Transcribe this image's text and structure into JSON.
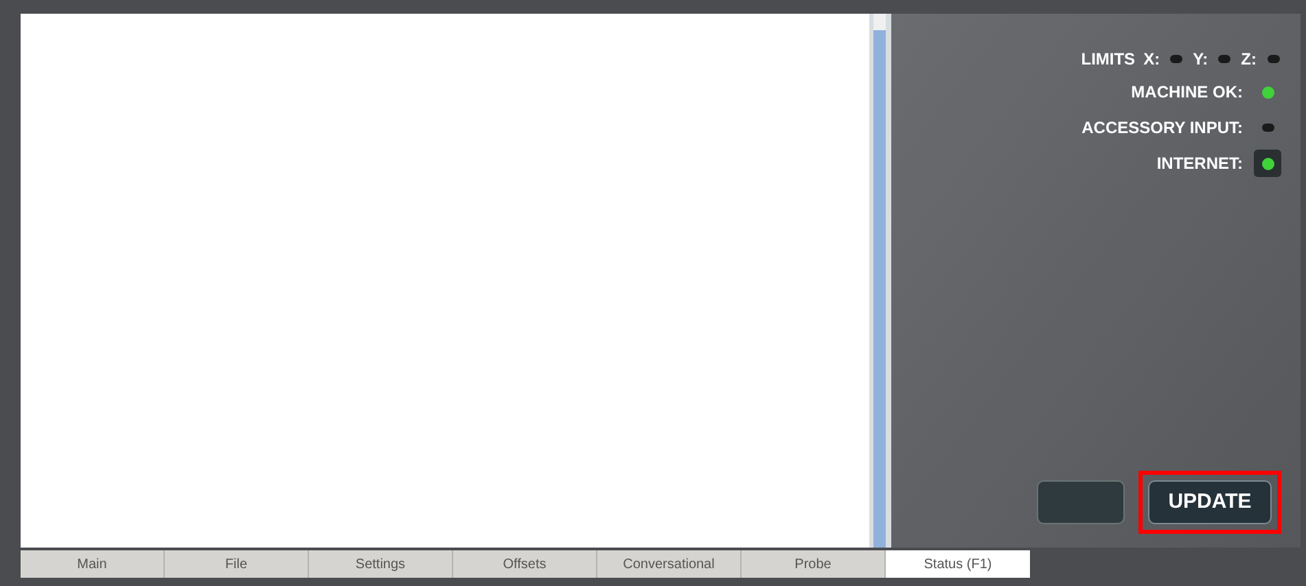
{
  "limits": {
    "label": "LIMITS",
    "axes": [
      {
        "label": "X:",
        "on": false
      },
      {
        "label": "Y:",
        "on": false
      },
      {
        "label": "Z:",
        "on": false
      }
    ]
  },
  "indicators": [
    {
      "label": "MACHINE OK:",
      "on": true,
      "kind": "dot"
    },
    {
      "label": "ACCESSORY INPUT:",
      "on": false,
      "kind": "dot"
    },
    {
      "label": "INTERNET:",
      "on": true,
      "kind": "boxed"
    }
  ],
  "update_button": {
    "label": "UPDATE",
    "highlighted": true
  },
  "tabs": [
    {
      "label": "Main",
      "selected": false
    },
    {
      "label": "File",
      "selected": false
    },
    {
      "label": "Settings",
      "selected": false
    },
    {
      "label": "Offsets",
      "selected": false
    },
    {
      "label": "Conversational",
      "selected": false
    },
    {
      "label": "Probe",
      "selected": false
    },
    {
      "label": "Status (F1)",
      "selected": true
    }
  ]
}
